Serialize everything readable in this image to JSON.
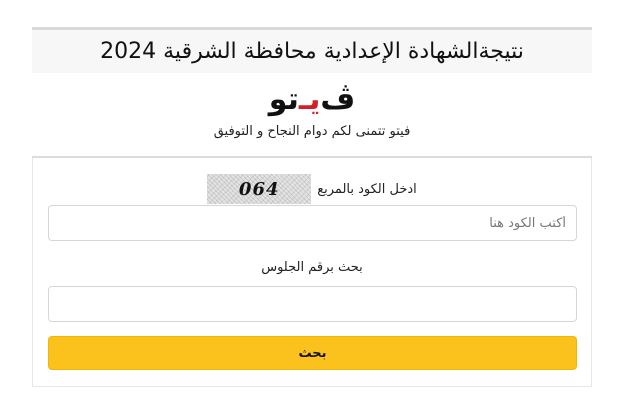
{
  "header": {
    "title": "نتيجةالشهادة الإعدادية محافظة الشرقية  2024"
  },
  "logo": {
    "part1": "ڤ",
    "part2": "يـ",
    "part3": "تو"
  },
  "tagline": "فيتو تتمنى لكم دوام النجاح و التوفيق",
  "form": {
    "captcha_label": "ادخل الكود بالمربع",
    "captcha_code": "064",
    "code_placeholder": "أكتب الكود هنا",
    "code_value": "",
    "seat_label": "بحث برقم الجلوس",
    "seat_value": "",
    "search_button": "بحث"
  },
  "colors": {
    "accent": "#fbc11d",
    "logo_red": "#d21f26"
  }
}
